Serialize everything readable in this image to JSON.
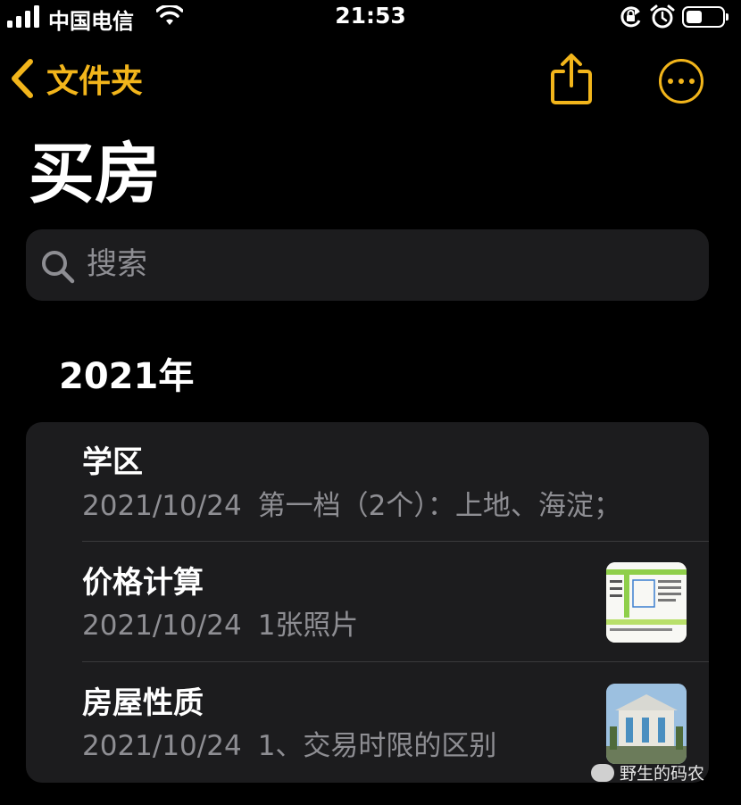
{
  "status_bar": {
    "carrier": "中国电信",
    "time": "21:53",
    "battery_level": 0.45
  },
  "nav": {
    "back_label": "文件夹"
  },
  "title": "买房",
  "search": {
    "placeholder": "搜索"
  },
  "section": "2021年",
  "notes": [
    {
      "title": "学区",
      "date": "2021/10/24",
      "preview": "第一档（2个）：上地、海淀；",
      "thumbnail": null
    },
    {
      "title": "价格计算",
      "date": "2021/10/24",
      "preview": "1张照片",
      "thumbnail": "table-photo"
    },
    {
      "title": "房屋性质",
      "date": "2021/10/24",
      "preview": "1、交易时限的区别",
      "thumbnail": "building-photo"
    }
  ],
  "watermark": "野生的码农",
  "colors": {
    "accent": "#f2b51b",
    "background": "#000000",
    "card": "#1c1c1e",
    "secondary_text": "#8e8e93"
  }
}
